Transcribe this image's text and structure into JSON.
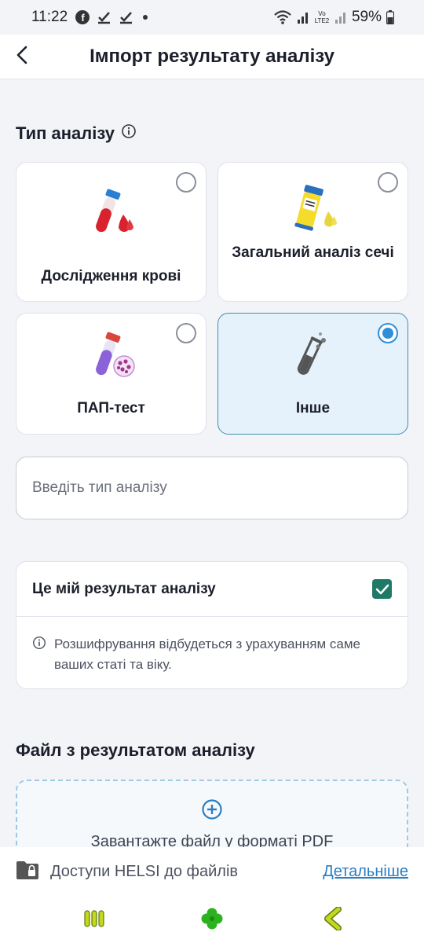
{
  "status_bar": {
    "time": "11:22",
    "battery": "59%",
    "network": "Vo LTE2"
  },
  "header": {
    "title": "Імпорт результату аналізу",
    "back_icon": "chevron-left-icon"
  },
  "analysis_type": {
    "title": "Тип аналізу",
    "info_icon": "info-icon",
    "options": [
      {
        "label": "Дослідження крові",
        "icon": "blood-tube-icon",
        "selected": false
      },
      {
        "label": "Загальний аналіз сечі",
        "icon": "urine-container-icon",
        "selected": false
      },
      {
        "label": "ПАП-тест",
        "icon": "pap-test-tube-icon",
        "selected": false
      },
      {
        "label": "Інше",
        "icon": "test-tube-icon",
        "selected": true
      }
    ],
    "input_placeholder": "Введіть тип аналізу",
    "input_value": ""
  },
  "my_result": {
    "label": "Це мій результат аналізу",
    "checked": true,
    "info_text": "Розшифрування відбудеться з урахуванням саме ваших статі та віку."
  },
  "file_section": {
    "title": "Файл з результатом аналізу",
    "upload_text": "Завантажте файл у форматі PDF"
  },
  "footer": {
    "access_text": "Доступи HELSI до файлів",
    "details_link": "Детальніше"
  },
  "colors": {
    "accent_blue": "#2f8fd9",
    "selected_card_bg": "#e5f2fb",
    "checkbox_green": "#1e7a67",
    "link_blue": "#2b7ec1",
    "nav_green": "#2bb21f",
    "nav_yellow": "#c6d71d"
  }
}
